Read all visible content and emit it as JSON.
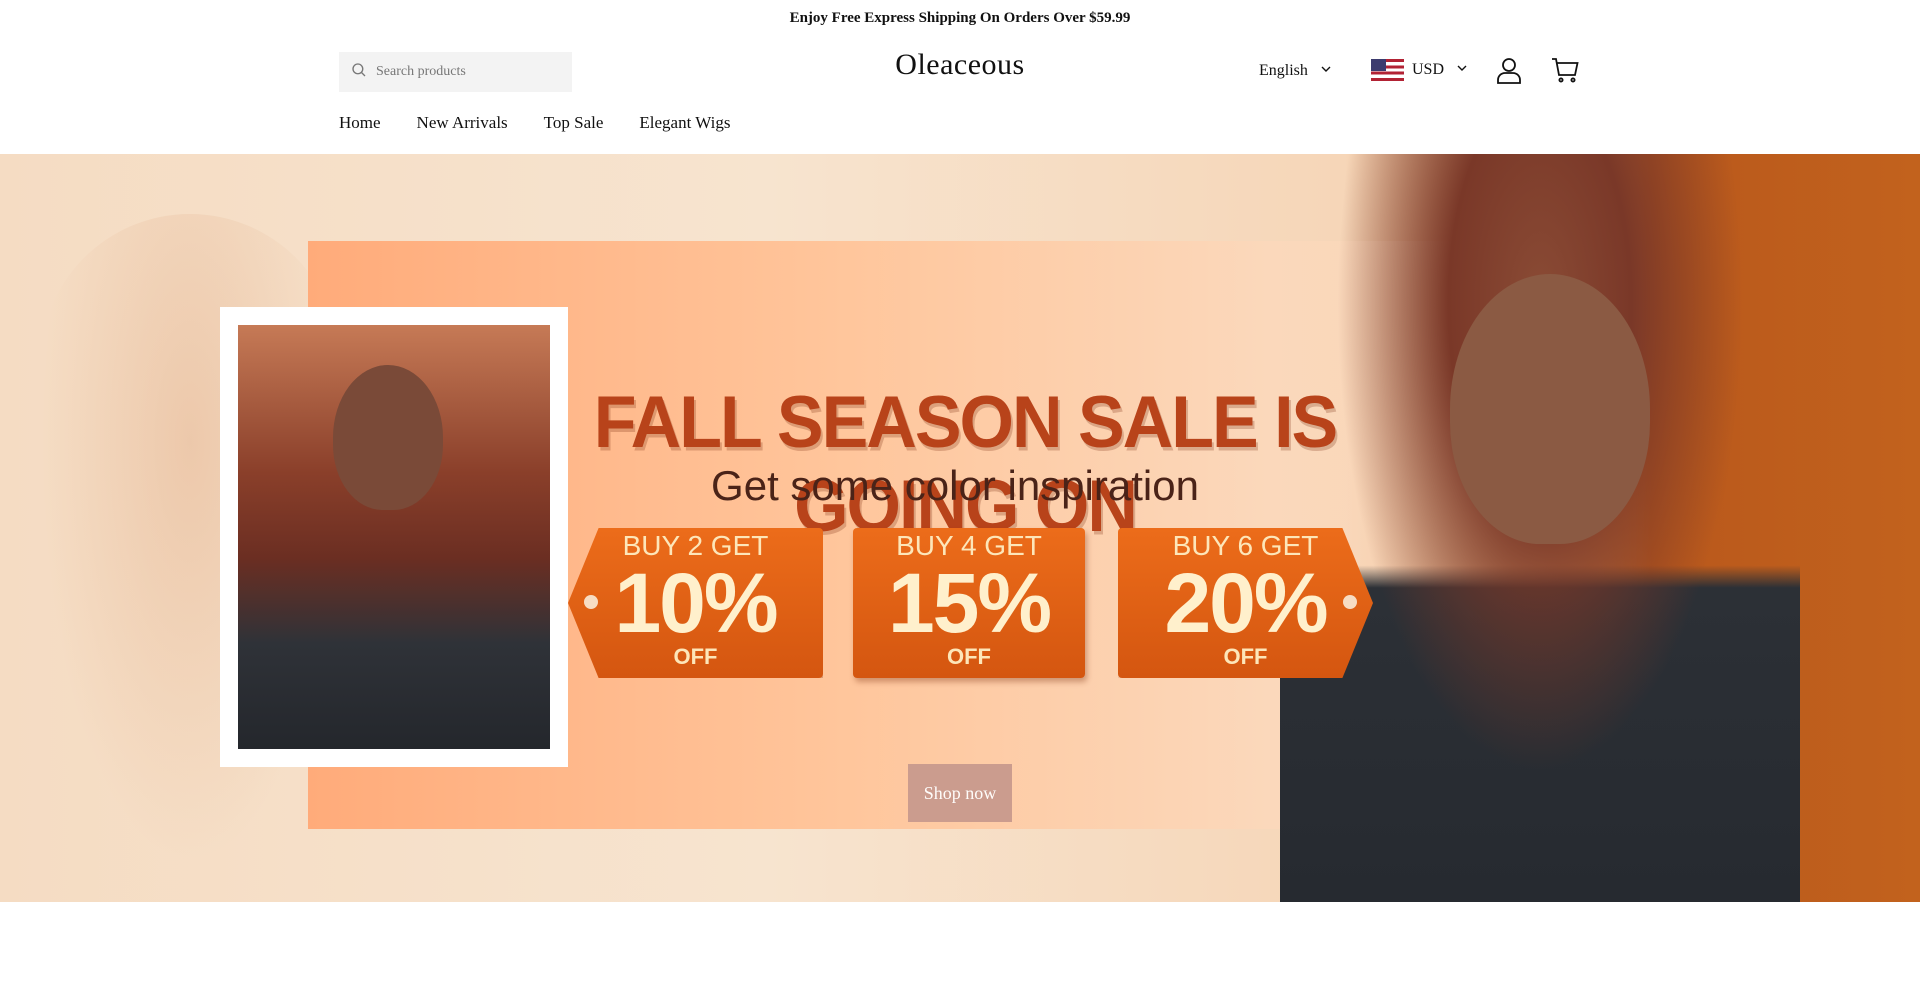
{
  "announcement": "Enjoy Free Express Shipping On Orders Over $59.99",
  "header": {
    "search_placeholder": "Search products",
    "logo": "Oleaceous",
    "language": "English",
    "currency": "USD"
  },
  "nav": {
    "items": [
      "Home",
      "New Arrivals",
      "Top Sale",
      "Elegant Wigs"
    ]
  },
  "hero": {
    "title": "FALL SEASON SALE IS GOING ON",
    "subtitle": "Get some color inspiration",
    "tags": [
      {
        "line1": "BUY 2 GET",
        "percent": "10%",
        "line3": "OFF"
      },
      {
        "line1": "BUY 4 GET",
        "percent": "15%",
        "line3": "OFF"
      },
      {
        "line1": "BUY 6 GET",
        "percent": "20%",
        "line3": "OFF"
      }
    ],
    "cta": "Shop now"
  },
  "icons": [
    "search-icon",
    "chevron-down-icon",
    "us-flag-icon",
    "user-icon",
    "cart-icon"
  ]
}
